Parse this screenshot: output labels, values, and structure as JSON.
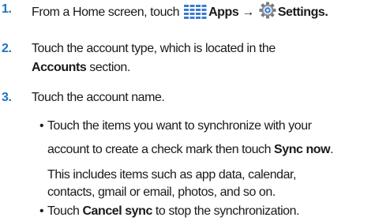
{
  "steps": [
    {
      "number": "1.",
      "text": {
        "before": "From a Home screen, touch",
        "apps": "Apps",
        "arrow": "→",
        "settings": "Settings."
      }
    },
    {
      "number": "2.",
      "line1": "Touch the account type, which is located in the",
      "accounts": "Accounts",
      "section": " section."
    },
    {
      "number": "3.",
      "line1": "Touch the account name.",
      "bullets": [
        {
          "bullet": "•",
          "line1": "Touch the items you want to synchronize with your",
          "line2_before": "account to create a check mark then touch ",
          "line2_bold": "Sync now",
          "line2_after": ".",
          "para_line1": "This includes items such as app data, calendar,",
          "para_line2": "contacts, gmail or email, photos, and so on."
        },
        {
          "bullet": "•",
          "before": "Touch ",
          "bold": "Cancel sync",
          "after": " to stop the synchronization."
        }
      ]
    }
  ],
  "icons": {
    "apps": "apps-grid-icon",
    "settings": "settings-gear-icon"
  },
  "colors": {
    "step_number": "#1e73be",
    "text": "#1a1a1a",
    "icon_blue": "#3a7bd5",
    "gear": "#6c6c6c"
  }
}
